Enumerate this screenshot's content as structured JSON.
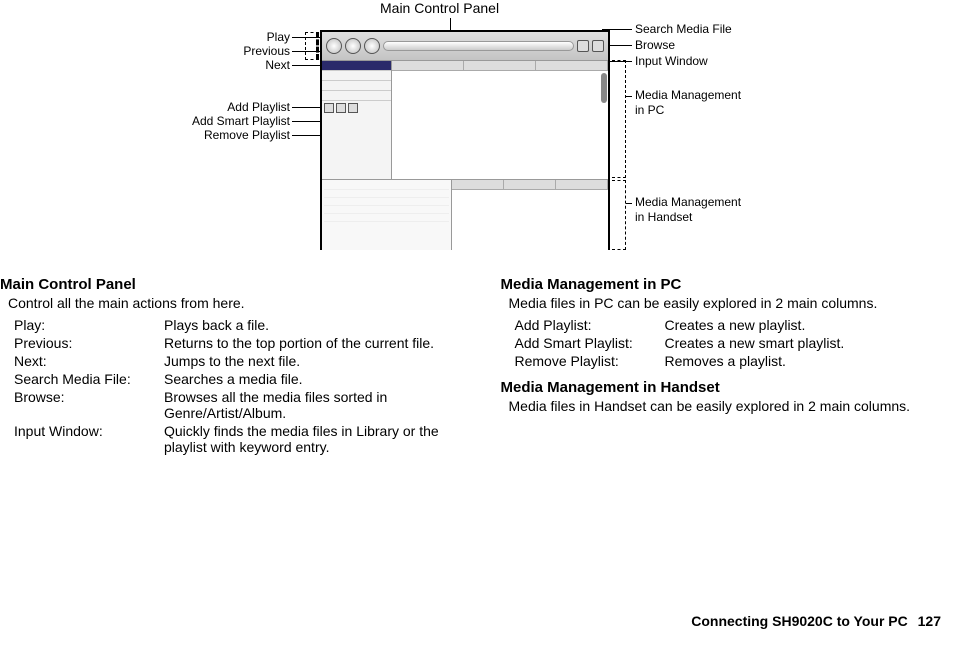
{
  "diagram": {
    "title": "Main Control Panel",
    "left_labels": {
      "play": "Play",
      "previous": "Previous",
      "next": "Next",
      "add_playlist": "Add Playlist",
      "add_smart_playlist": "Add Smart Playlist",
      "remove_playlist": "Remove Playlist"
    },
    "right_labels": {
      "search_media_file": "Search Media File",
      "browse": "Browse",
      "input_window": "Input Window",
      "media_mgmt_pc_l1": "Media Management",
      "media_mgmt_pc_l2": "in PC",
      "media_mgmt_hs_l1": "Media Management",
      "media_mgmt_hs_l2": "in Handset"
    }
  },
  "sections": {
    "main_control": {
      "title": "Main Control Panel",
      "subtitle": "Control all the main actions from here.",
      "items": [
        {
          "term": "Play:",
          "desc": "Plays back a file."
        },
        {
          "term": "Previous:",
          "desc": "Returns to the top portion of the current file."
        },
        {
          "term": "Next:",
          "desc": "Jumps to the next file."
        },
        {
          "term": "Search Media File:",
          "desc": "Searches a media file."
        },
        {
          "term": "Browse:",
          "desc": "Browses all the media files sorted in Genre/Artist/Album."
        },
        {
          "term": "Input Window:",
          "desc": "Quickly finds the media files in Library or the playlist with keyword entry."
        }
      ]
    },
    "mgmt_pc": {
      "title": "Media Management in PC",
      "subtitle": "Media files in PC can be easily explored in 2 main columns.",
      "items": [
        {
          "term": "Add Playlist:",
          "desc": "Creates a new playlist."
        },
        {
          "term": "Add Smart Playlist:",
          "desc": "Creates a new smart playlist."
        },
        {
          "term": "Remove Playlist:",
          "desc": "Removes a playlist."
        }
      ]
    },
    "mgmt_hs": {
      "title": "Media Management in Handset",
      "subtitle": "Media files in Handset can be easily explored in 2 main columns."
    }
  },
  "footer": {
    "text": "Connecting SH9020C to Your PC",
    "page": "127"
  }
}
